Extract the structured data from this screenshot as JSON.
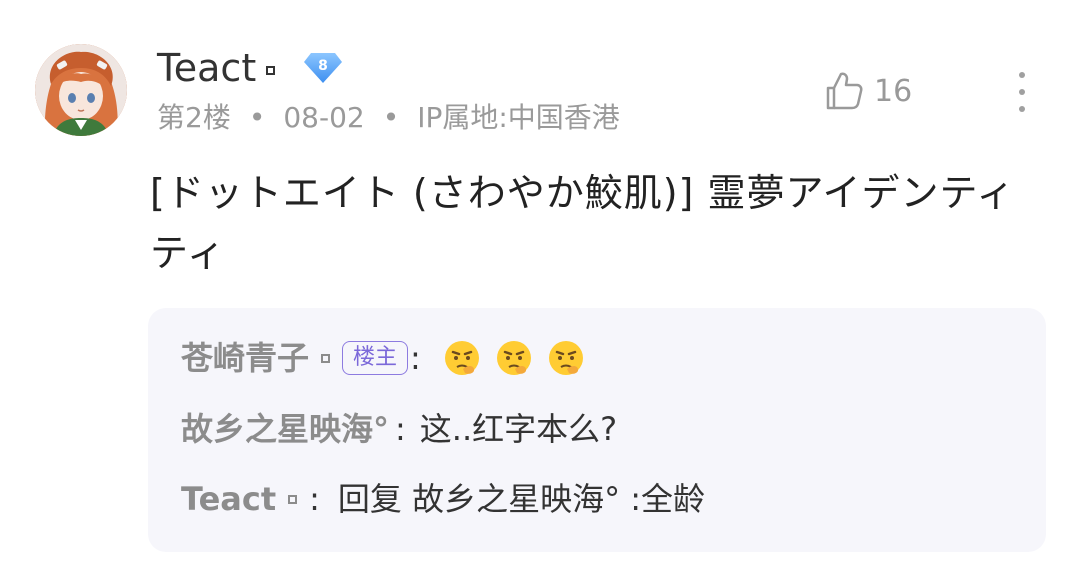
{
  "post": {
    "username": "Teact",
    "level": "8",
    "floor": "第2楼",
    "date": "08-02",
    "ip_location": "IP属地:中国香港",
    "like_count": "16",
    "content": "[ドットエイト (さわやか鮫肌)] 霊夢アイデンティティ"
  },
  "replies": [
    {
      "author": "苍崎青子",
      "owner_tag": "楼主",
      "colon": ":",
      "emojis": [
        "thinking-face-icon",
        "thinking-face-icon",
        "thinking-face-icon"
      ],
      "text": ""
    },
    {
      "author": "故乡之星映海°",
      "colon": ":",
      "text": "这..红字本么?"
    },
    {
      "author": "Teact",
      "colon": ":",
      "text": "回复 故乡之星映海° :全龄"
    }
  ],
  "colors": {
    "accent_purple": "#7b68d9",
    "badge_blue": "#4a9ef5",
    "reply_bg": "#f6f6fb",
    "meta_gray": "#9a9a9a"
  },
  "icons": [
    "avatar",
    "level-badge-icon",
    "like-thumb-icon",
    "more-vertical-icon",
    "thinking-face-icon"
  ]
}
